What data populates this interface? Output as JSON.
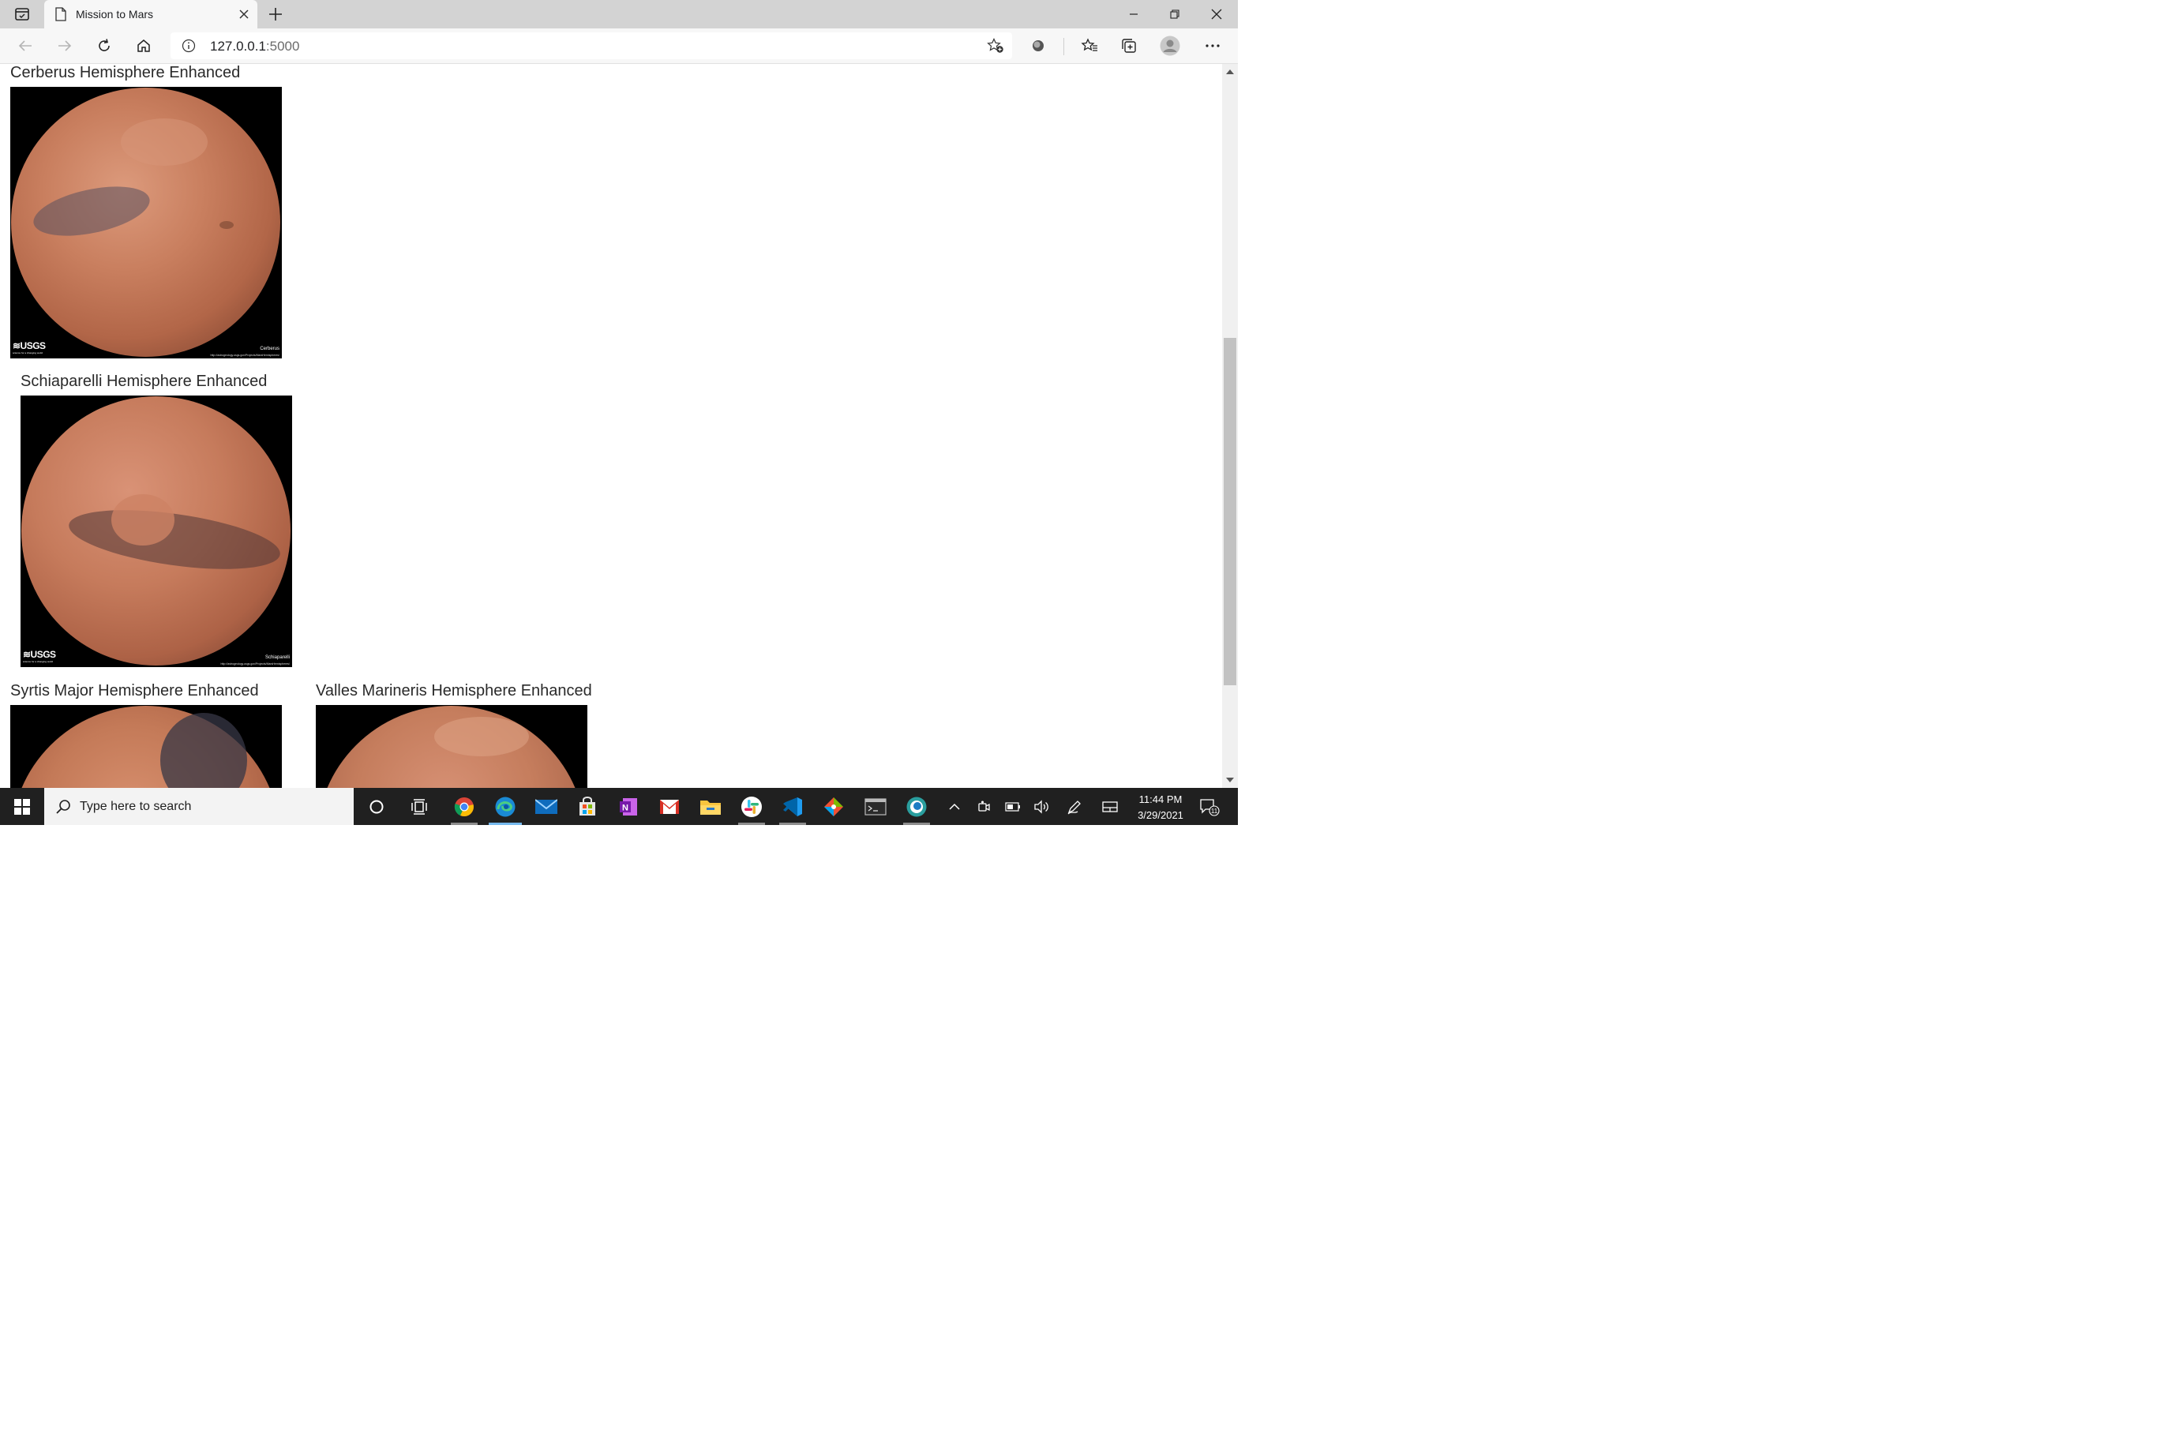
{
  "browser": {
    "tab_title": "Mission to Mars",
    "address_host": "127.0.0.1",
    "address_port": ":5000"
  },
  "hemispheres": [
    {
      "title": "Cerberus Hemisphere Enhanced",
      "caption": "Cerberus"
    },
    {
      "title": "Schiaparelli Hemisphere Enhanced",
      "caption": "Schiaparelli"
    },
    {
      "title": "Syrtis Major Hemisphere Enhanced",
      "caption": ""
    },
    {
      "title": "Valles Marineris Hemisphere Enhanced",
      "caption": ""
    }
  ],
  "image_branding": {
    "logo": "USGS",
    "tagline": "science for a changing world",
    "credit_url": "http://astrogeology.usgs.gov/Projects/MarsHemispheres/"
  },
  "taskbar": {
    "search_placeholder": "Type here to search",
    "time": "11:44 PM",
    "date": "3/29/2021",
    "notification_count": "11",
    "apps": [
      "cortana-icon",
      "task-view-icon",
      "chrome-icon",
      "edge-icon",
      "mail-icon",
      "store-icon",
      "onenote-icon",
      "gmail-icon",
      "file-explorer-icon",
      "slack-icon",
      "vscode-icon",
      "git-icon",
      "terminal-icon",
      "edge-dev-icon"
    ]
  },
  "colors": {
    "mars_light": "#d4866a",
    "mars_mid": "#b9694a",
    "mars_dark": "#6b4437",
    "taskbar_bg": "#202020",
    "tab_bar_bg": "#d3d3d3"
  }
}
